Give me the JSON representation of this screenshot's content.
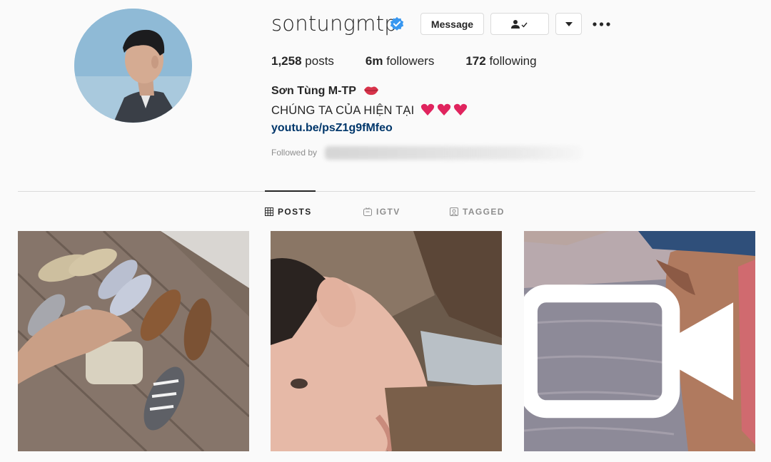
{
  "profile": {
    "username": "sontungmtp",
    "message_label": "Message",
    "full_name": "Sơn Tùng M-TP",
    "bio": "CHÚNG TA CỦA HIỆN TẠI",
    "link": "youtu.be/psZ1g9fMfeo",
    "followed_by_label": "Followed by"
  },
  "stats": {
    "posts_count": "1,258",
    "posts_label": "posts",
    "followers_count": "6m",
    "followers_label": "followers",
    "following_count": "172",
    "following_label": "following"
  },
  "tabs": [
    {
      "label": "POSTS",
      "active": true
    },
    {
      "label": "IGTV",
      "active": false
    },
    {
      "label": "TAGGED",
      "active": false
    }
  ],
  "colors": {
    "verified": "#3897f0",
    "link": "#00376b",
    "heart": "#e0245e"
  },
  "icons": {
    "verified": "verified-badge-icon",
    "follow": "following-person-check-icon",
    "dropdown": "chevron-down-icon",
    "more": "more-dots-icon",
    "posts_tab": "grid-icon",
    "igtv_tab": "igtv-icon",
    "tagged_tab": "tagged-icon",
    "video": "video-camera-icon"
  }
}
